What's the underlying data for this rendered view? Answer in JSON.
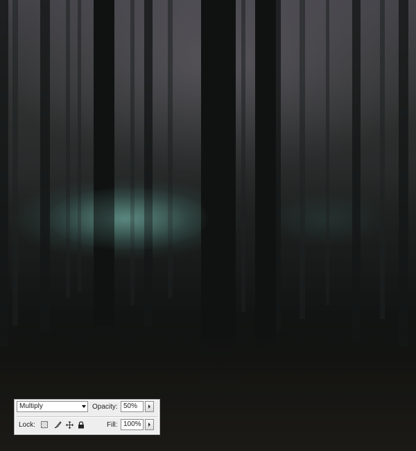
{
  "canvas": {
    "description_colors": {
      "sky": "#45444a",
      "ground": "#1e1c18",
      "glow": "#78b9af"
    }
  },
  "layer_options": {
    "blend_mode": "Multiply",
    "opacity_label": "Opacity:",
    "opacity_value": "50%",
    "lock_label": "Lock:",
    "fill_label": "Fill:",
    "fill_value": "100%",
    "lock_icons": [
      "lock-transparent-pixels-icon",
      "lock-image-pixels-icon",
      "lock-position-icon",
      "lock-all-icon"
    ]
  }
}
